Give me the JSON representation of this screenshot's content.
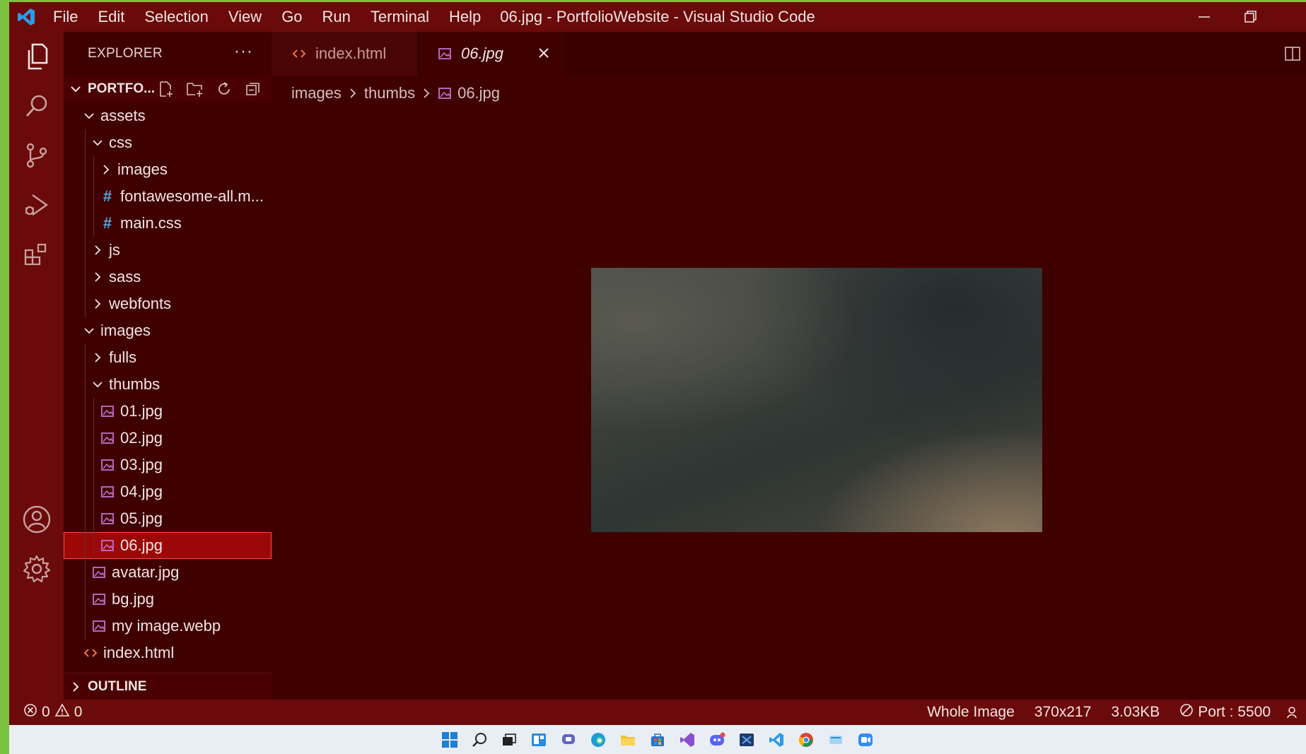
{
  "window": {
    "title": "06.jpg - PortfolioWebsite - Visual Studio Code",
    "menu": [
      "File",
      "Edit",
      "Selection",
      "View",
      "Go",
      "Run",
      "Terminal",
      "Help"
    ]
  },
  "activity_bar": {
    "items": [
      "explorer-icon",
      "search-icon",
      "source-control-icon",
      "run-debug-icon",
      "extensions-icon"
    ],
    "bottom": [
      "accounts-icon",
      "settings-gear-icon"
    ]
  },
  "sidebar": {
    "header": "EXPLORER",
    "more": "···",
    "section_title": "PORTFO...",
    "tree": [
      {
        "label": "assets",
        "kind": "folder-open",
        "depth": 0
      },
      {
        "label": "css",
        "kind": "folder-open",
        "depth": 1
      },
      {
        "label": "images",
        "kind": "folder",
        "depth": 2
      },
      {
        "label": "fontawesome-all.m...",
        "kind": "css",
        "depth": 2
      },
      {
        "label": "main.css",
        "kind": "css",
        "depth": 2
      },
      {
        "label": "js",
        "kind": "folder",
        "depth": 1
      },
      {
        "label": "sass",
        "kind": "folder",
        "depth": 1
      },
      {
        "label": "webfonts",
        "kind": "folder",
        "depth": 1
      },
      {
        "label": "images",
        "kind": "folder-open",
        "depth": 0
      },
      {
        "label": "fulls",
        "kind": "folder",
        "depth": 1
      },
      {
        "label": "thumbs",
        "kind": "folder-open",
        "depth": 1
      },
      {
        "label": "01.jpg",
        "kind": "image",
        "depth": 2
      },
      {
        "label": "02.jpg",
        "kind": "image",
        "depth": 2
      },
      {
        "label": "03.jpg",
        "kind": "image",
        "depth": 2
      },
      {
        "label": "04.jpg",
        "kind": "image",
        "depth": 2
      },
      {
        "label": "05.jpg",
        "kind": "image",
        "depth": 2
      },
      {
        "label": "06.jpg",
        "kind": "image",
        "depth": 2,
        "selected": true
      },
      {
        "label": "avatar.jpg",
        "kind": "image",
        "depth": 1
      },
      {
        "label": "bg.jpg",
        "kind": "image",
        "depth": 1
      },
      {
        "label": "my image.webp",
        "kind": "image",
        "depth": 1
      },
      {
        "label": "index.html",
        "kind": "html",
        "depth": 0
      }
    ],
    "outline_title": "OUTLINE"
  },
  "editor": {
    "tabs": [
      {
        "label": "index.html",
        "kind": "html",
        "active": false
      },
      {
        "label": "06.jpg",
        "kind": "image",
        "active": true
      }
    ],
    "breadcrumb": [
      "images",
      "thumbs",
      "06.jpg"
    ]
  },
  "status_bar": {
    "errors": "0",
    "warnings": "0",
    "zoom": "Whole Image",
    "dimensions": "370x217",
    "file_size": "3.03KB",
    "port": "Port : 5500"
  },
  "colors": {
    "titlebar": "#6b0a0a",
    "sidebar": "#3f0000",
    "selection": "#9c0808",
    "accent_green": "#7cc241"
  }
}
